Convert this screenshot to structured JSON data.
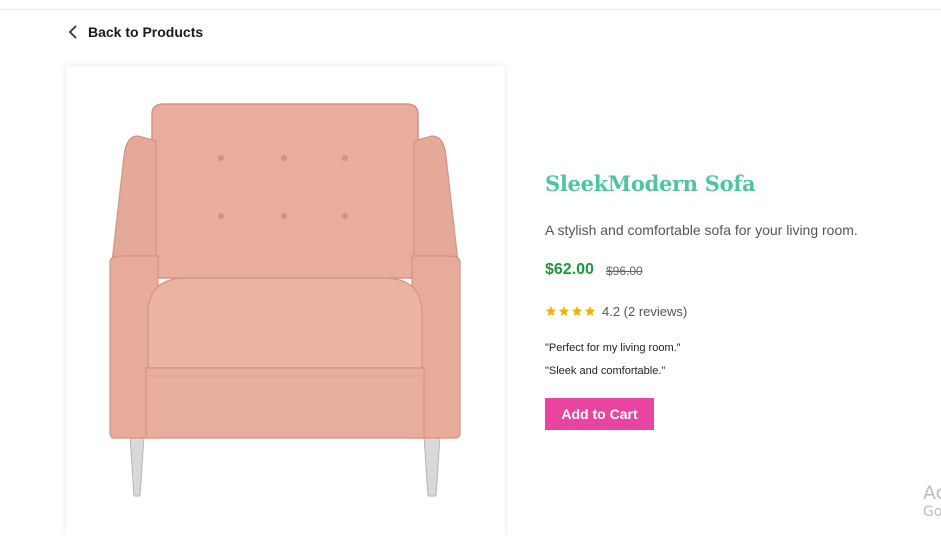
{
  "nav": {
    "back_label": "Back to Products"
  },
  "product": {
    "name": "SleekModern Sofa",
    "description": "A stylish and comfortable sofa for your living room.",
    "price": "$62.00",
    "original_price": "$96.00",
    "rating": {
      "stars": 4,
      "text": "4.2 (2 reviews)"
    },
    "reviews": [
      "\"Perfect for my living room.\"",
      "\"Sleek and comfortable.\""
    ],
    "image_icon": "pink-armchair"
  },
  "actions": {
    "add_to_cart_label": "Add to Cart"
  },
  "watermark": {
    "line1": "Ac",
    "line2": "Go"
  },
  "colors": {
    "title": "#4fc4a3",
    "price": "#1d9a3e",
    "button": "#e944a0",
    "star": "#f0b400",
    "sofa": "#e9b0a0"
  }
}
